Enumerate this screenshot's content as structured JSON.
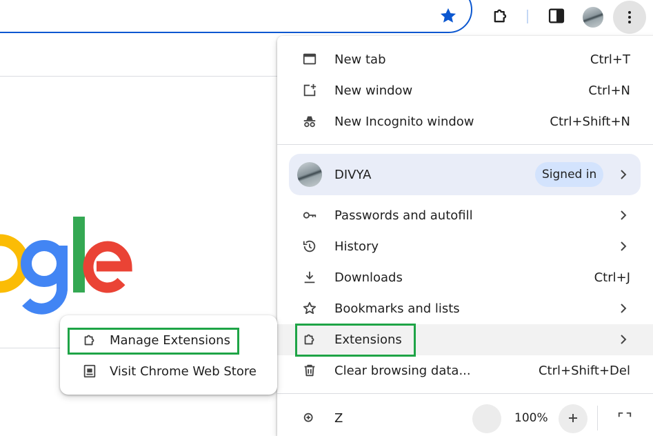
{
  "toolbar": {
    "icons": [
      "bookmark-star-icon",
      "extensions-puzzle-icon",
      "side-panel-icon",
      "profile-avatar",
      "more-menu-icon"
    ],
    "accent": "#0b57d0"
  },
  "menu": {
    "items_top": [
      {
        "label": "New tab",
        "shortcut": "Ctrl+T",
        "icon": "new-tab-icon"
      },
      {
        "label": "New window",
        "shortcut": "Ctrl+N",
        "icon": "new-window-icon"
      },
      {
        "label": "New Incognito window",
        "shortcut": "Ctrl+Shift+N",
        "icon": "incognito-icon"
      }
    ],
    "profile": {
      "name": "DIVYA",
      "status": "Signed in"
    },
    "items_mid": [
      {
        "label": "Passwords and autofill",
        "icon": "key-icon",
        "has_submenu": true
      },
      {
        "label": "History",
        "icon": "history-icon",
        "has_submenu": true
      },
      {
        "label": "Downloads",
        "shortcut": "Ctrl+J",
        "icon": "download-icon"
      },
      {
        "label": "Bookmarks and lists",
        "icon": "star-icon",
        "has_submenu": true
      },
      {
        "label": "Extensions",
        "icon": "puzzle-icon",
        "has_submenu": true
      },
      {
        "label": "Clear browsing data...",
        "shortcut": "Ctrl+Shift+Del",
        "icon": "trash-icon"
      }
    ],
    "zoom": {
      "label": "Z",
      "value": "100%"
    }
  },
  "submenu": {
    "items": [
      {
        "label": "Manage Extensions",
        "icon": "puzzle-icon"
      },
      {
        "label": "Visit Chrome Web Store",
        "icon": "web-store-icon"
      }
    ]
  },
  "highlight_color": "#1ea446"
}
